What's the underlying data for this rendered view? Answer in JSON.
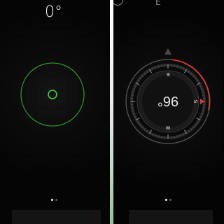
{
  "level": {
    "readout": "0°"
  },
  "compass": {
    "heading_top": "E",
    "dial_reading": "96°",
    "dial_letters": {
      "east": "E",
      "south": "S",
      "west": "W"
    }
  },
  "pager": {
    "count": 2,
    "active_index": 0
  },
  "colors": {
    "level_ring": "#2f8f2f",
    "level_bubble": "#3fcf3f",
    "compass_accent": "#e23a2a",
    "divider": "#e9ece9"
  }
}
